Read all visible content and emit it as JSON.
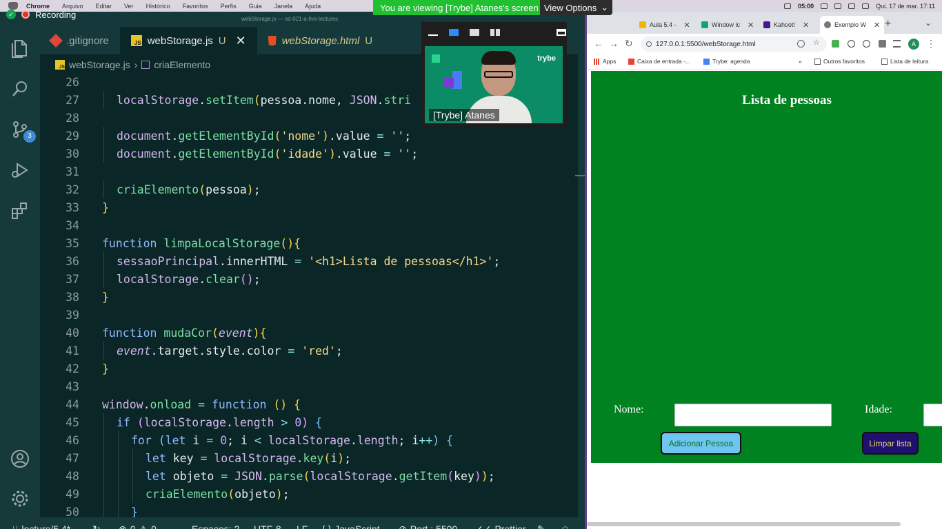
{
  "menubar": {
    "app": "Chrome",
    "items": [
      "Arquivo",
      "Editar",
      "Ver",
      "Histórico",
      "Favoritos",
      "Perfis",
      "Guia",
      "Janela",
      "Ajuda"
    ],
    "time_left": "05:00",
    "datetime": "Qui. 17 de mar.  17:11"
  },
  "zoom": {
    "banner": "You are viewing [Trybe] Atanes's screen",
    "view_options": "View Options",
    "recording": "Recording",
    "participant_name": "[Trybe] Atanes",
    "tile_brand": "trybe"
  },
  "vscode": {
    "window_title": "webStorage.js — sd-021-a-live-lectures",
    "tabs": [
      {
        "label": ".gitignore",
        "status": ""
      },
      {
        "label": "webStorage.js",
        "status": "U"
      },
      {
        "label": "webStorage.html",
        "status": "U"
      }
    ],
    "breadcrumb": {
      "file": "webStorage.js",
      "symbol": "criaElemento"
    },
    "source_control_badge": "3",
    "status": {
      "branch": "lecture/5.4*",
      "errors": "0",
      "warnings": "0",
      "spaces": "Espaços: 2",
      "encoding": "UTF-8",
      "eol": "LF",
      "language": "JavaScript",
      "port": "Port : 5500",
      "prettier": "Prettier"
    }
  },
  "code": [
    {
      "n": "26",
      "indent": 0,
      "tokens": []
    },
    {
      "n": "27",
      "indent": 1,
      "tokens": [
        [
          "vr",
          "localStorage"
        ],
        [
          "pr",
          "."
        ],
        [
          "fn",
          "setItem"
        ],
        [
          "pu",
          "("
        ],
        [
          "pr",
          "pessoa.nome, "
        ],
        [
          "vr",
          "JSON"
        ],
        [
          "pr",
          "."
        ],
        [
          "fn",
          "stri"
        ]
      ]
    },
    {
      "n": "28",
      "indent": 0,
      "tokens": []
    },
    {
      "n": "29",
      "indent": 1,
      "tokens": [
        [
          "vr",
          "document"
        ],
        [
          "pr",
          "."
        ],
        [
          "fn",
          "getElementById"
        ],
        [
          "pu",
          "("
        ],
        [
          "st",
          "'nome'"
        ],
        [
          "pu",
          ")"
        ],
        [
          "pr",
          ".value "
        ],
        [
          "op",
          "="
        ],
        [
          "pr",
          " "
        ],
        [
          "st",
          "''"
        ],
        [
          "pr",
          ";"
        ]
      ]
    },
    {
      "n": "30",
      "indent": 1,
      "tokens": [
        [
          "vr",
          "document"
        ],
        [
          "pr",
          "."
        ],
        [
          "fn",
          "getElementById"
        ],
        [
          "pu",
          "("
        ],
        [
          "st",
          "'idade'"
        ],
        [
          "pu",
          ")"
        ],
        [
          "pr",
          ".value "
        ],
        [
          "op",
          "="
        ],
        [
          "pr",
          " "
        ],
        [
          "st",
          "''"
        ],
        [
          "pr",
          ";"
        ]
      ]
    },
    {
      "n": "31",
      "indent": 0,
      "tokens": []
    },
    {
      "n": "32",
      "indent": 1,
      "tokens": [
        [
          "fn",
          "criaElemento"
        ],
        [
          "pu",
          "("
        ],
        [
          "pr",
          "pessoa"
        ],
        [
          "pu",
          ")"
        ],
        [
          "pr",
          ";"
        ]
      ]
    },
    {
      "n": "33",
      "indent": 0,
      "tokens": [
        [
          "pu",
          "}"
        ]
      ]
    },
    {
      "n": "34",
      "indent": 0,
      "tokens": []
    },
    {
      "n": "35",
      "indent": 0,
      "tokens": [
        [
          "kw",
          "function "
        ],
        [
          "fn",
          "limpaLocalStorage"
        ],
        [
          "pu",
          "(){"
        ]
      ]
    },
    {
      "n": "36",
      "indent": 1,
      "tokens": [
        [
          "vr",
          "sessaoPrincipal"
        ],
        [
          "pr",
          ".innerHTML "
        ],
        [
          "op",
          "="
        ],
        [
          "pr",
          " "
        ],
        [
          "st",
          "'<h1>Lista de pessoas</h1>'"
        ],
        [
          "pr",
          ";"
        ]
      ]
    },
    {
      "n": "37",
      "indent": 1,
      "tokens": [
        [
          "vr",
          "localStorage"
        ],
        [
          "pr",
          "."
        ],
        [
          "fn",
          "clear"
        ],
        [
          "pn",
          "()"
        ],
        [
          "pr",
          ";"
        ]
      ]
    },
    {
      "n": "38",
      "indent": 0,
      "tokens": [
        [
          "pu",
          "}"
        ]
      ]
    },
    {
      "n": "39",
      "indent": 0,
      "tokens": []
    },
    {
      "n": "40",
      "indent": 0,
      "tokens": [
        [
          "kw",
          "function "
        ],
        [
          "fn",
          "mudaCor"
        ],
        [
          "pu",
          "("
        ],
        [
          "it",
          "event"
        ],
        [
          "pu",
          "){"
        ]
      ]
    },
    {
      "n": "41",
      "indent": 1,
      "tokens": [
        [
          "it",
          "event"
        ],
        [
          "pr",
          ".target.style.color "
        ],
        [
          "op",
          "="
        ],
        [
          "pr",
          " "
        ],
        [
          "st",
          "'red'"
        ],
        [
          "pr",
          ";"
        ]
      ]
    },
    {
      "n": "42",
      "indent": 0,
      "tokens": [
        [
          "pu",
          "}"
        ]
      ]
    },
    {
      "n": "43",
      "indent": 0,
      "tokens": []
    },
    {
      "n": "44",
      "indent": 0,
      "tokens": [
        [
          "vr",
          "window"
        ],
        [
          "pr",
          "."
        ],
        [
          "fn",
          "onload"
        ],
        [
          "pr",
          " "
        ],
        [
          "op",
          "="
        ],
        [
          "pr",
          " "
        ],
        [
          "kw",
          "function "
        ],
        [
          "pu",
          "() {"
        ]
      ]
    },
    {
      "n": "45",
      "indent": 1,
      "tokens": [
        [
          "kw",
          "if "
        ],
        [
          "pn",
          "("
        ],
        [
          "vr",
          "localStorage"
        ],
        [
          "pr",
          "."
        ],
        [
          "vr",
          "length"
        ],
        [
          "pr",
          " "
        ],
        [
          "op",
          ">"
        ],
        [
          "pr",
          " "
        ],
        [
          "nm",
          "0"
        ],
        [
          "pn",
          ")"
        ],
        [
          "pr",
          " "
        ],
        [
          "pa",
          "{"
        ]
      ]
    },
    {
      "n": "46",
      "indent": 2,
      "tokens": [
        [
          "kw",
          "for "
        ],
        [
          "pa",
          "("
        ],
        [
          "kw",
          "let"
        ],
        [
          "pr",
          " i "
        ],
        [
          "op",
          "="
        ],
        [
          "pr",
          " "
        ],
        [
          "nm",
          "0"
        ],
        [
          "pr",
          "; i "
        ],
        [
          "op",
          "<"
        ],
        [
          "pr",
          " "
        ],
        [
          "vr",
          "localStorage"
        ],
        [
          "pr",
          "."
        ],
        [
          "vr",
          "length"
        ],
        [
          "pr",
          "; i"
        ],
        [
          "op",
          "++"
        ],
        [
          "pa",
          ")"
        ],
        [
          "pr",
          " "
        ],
        [
          "pa",
          "{"
        ]
      ]
    },
    {
      "n": "47",
      "indent": 3,
      "tokens": [
        [
          "kw",
          "let"
        ],
        [
          "pr",
          " key "
        ],
        [
          "op",
          "="
        ],
        [
          "pr",
          " "
        ],
        [
          "vr",
          "localStorage"
        ],
        [
          "pr",
          "."
        ],
        [
          "fn",
          "key"
        ],
        [
          "pu",
          "("
        ],
        [
          "pr",
          "i"
        ],
        [
          "pu",
          ")"
        ],
        [
          "pr",
          ";"
        ]
      ]
    },
    {
      "n": "48",
      "indent": 3,
      "tokens": [
        [
          "kw",
          "let"
        ],
        [
          "pr",
          " objeto "
        ],
        [
          "op",
          "="
        ],
        [
          "pr",
          " "
        ],
        [
          "vr",
          "JSON"
        ],
        [
          "pr",
          "."
        ],
        [
          "fn",
          "parse"
        ],
        [
          "pu",
          "("
        ],
        [
          "vr",
          "localStorage"
        ],
        [
          "pr",
          "."
        ],
        [
          "fn",
          "getItem"
        ],
        [
          "pn",
          "("
        ],
        [
          "pr",
          "key"
        ],
        [
          "pn",
          ")"
        ],
        [
          "pu",
          ")"
        ],
        [
          "pr",
          ";"
        ]
      ]
    },
    {
      "n": "49",
      "indent": 3,
      "tokens": [
        [
          "fn",
          "criaElemento"
        ],
        [
          "pu",
          "("
        ],
        [
          "pr",
          "objeto"
        ],
        [
          "pu",
          ")"
        ],
        [
          "pr",
          ";"
        ]
      ]
    },
    {
      "n": "50",
      "indent": 2,
      "tokens": [
        [
          "pa",
          "}"
        ]
      ]
    }
  ],
  "chrome": {
    "tabs": [
      {
        "label": "Aula 5.4 -",
        "color": "#f5b400"
      },
      {
        "label": "Window lc",
        "color": "#11a37f"
      },
      {
        "label": "Kahoot!",
        "color": "#46178f"
      },
      {
        "label": "Exemplo W",
        "color": "#777777"
      }
    ],
    "url": "127.0.0.1:5500/webStorage.html",
    "avatar": "A",
    "bookmarks": [
      "Apps",
      "Caixa de entrada -...",
      "Trybe: agenda",
      "Outros favoritos",
      "Lista de leitura"
    ],
    "page": {
      "title": "Lista de pessoas",
      "name_label": "Nome:",
      "age_label": "Idade:",
      "name_value": "",
      "age_value": "",
      "add_button": "Adicionar Pessoa",
      "clear_button": "Limpar lista"
    }
  },
  "colors": {
    "editor_bg": "#0b2627",
    "page_bg": "#008220",
    "add_button_bg": "#6ec6f0",
    "clear_button_bg": "#1f0f6e"
  }
}
